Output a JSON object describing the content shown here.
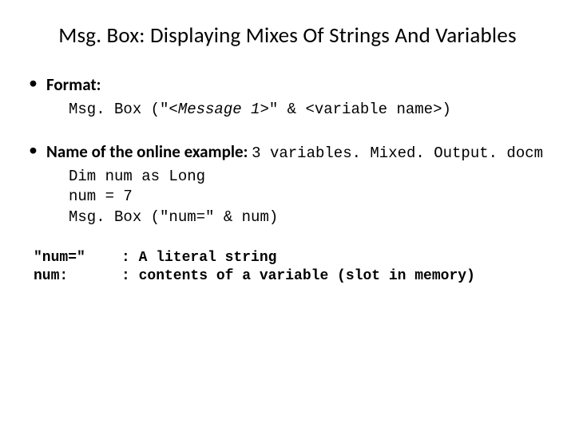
{
  "title": "Msg. Box: Displaying Mixes Of Strings And Variables",
  "bullets": {
    "format": {
      "label": "Format:",
      "code_pre": "Msg. Box (\"",
      "code_italic": "<Message 1>",
      "code_post": "\" & <variable name>)"
    },
    "example": {
      "label": "Name of the online example:",
      "filename": "3 variables. Mixed. Output. docm",
      "code": "Dim num as Long\nnum = 7\nMsg. Box (\"num=\" & num)"
    }
  },
  "definitions": [
    {
      "term": "\"num=\"",
      "desc": ": A literal string"
    },
    {
      "term": "num:",
      "desc": ": contents of a variable (slot in memory)"
    }
  ]
}
